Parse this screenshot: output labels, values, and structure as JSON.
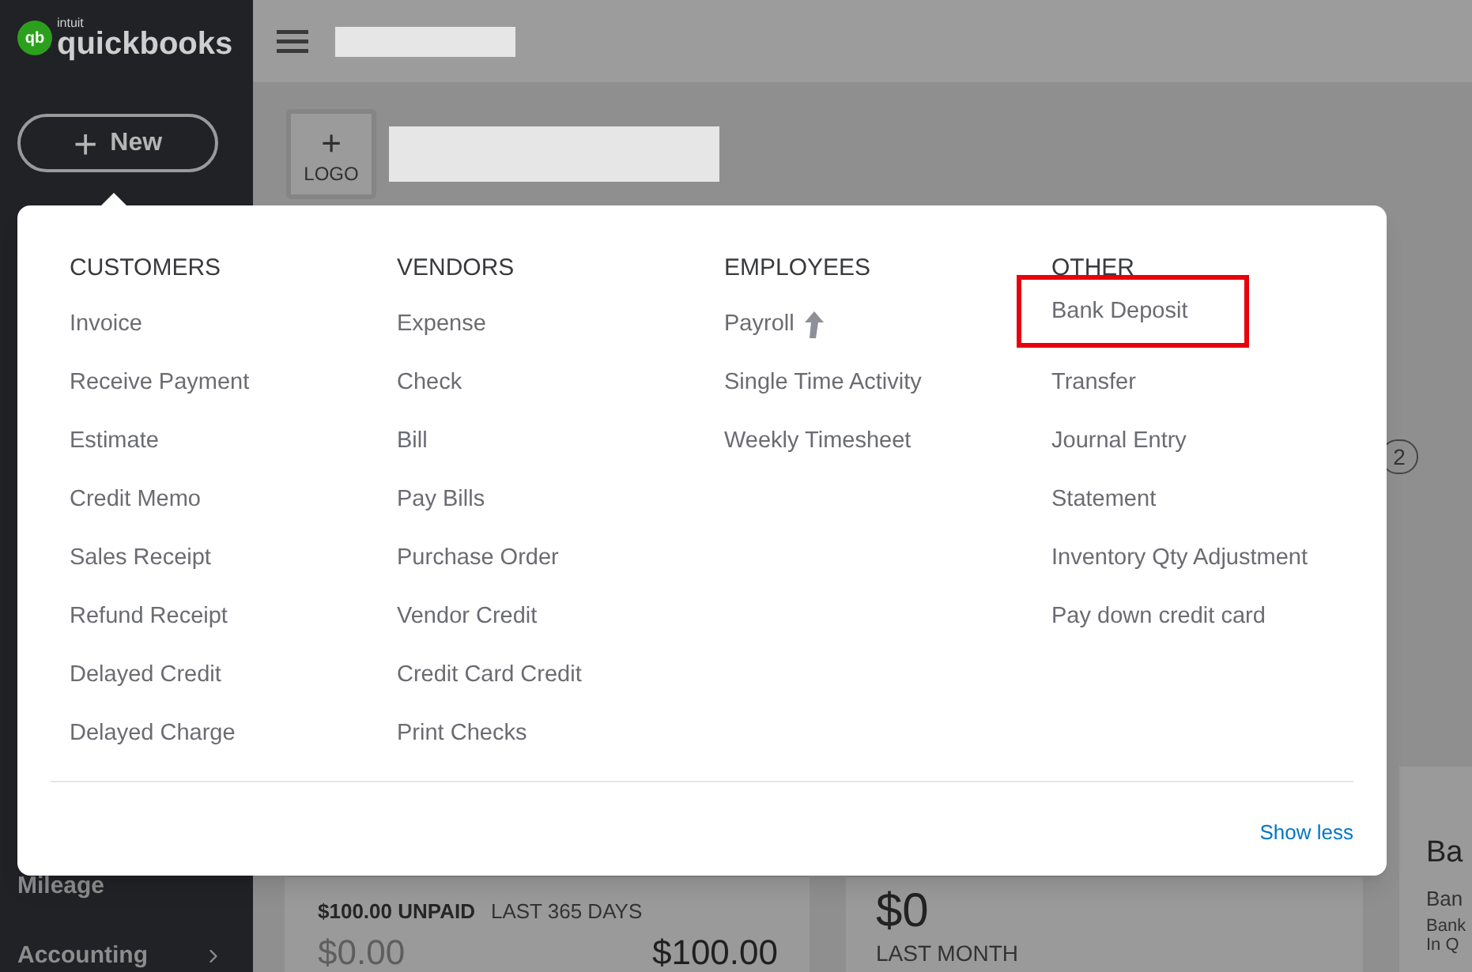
{
  "sidebar": {
    "logo": {
      "brand_small": "intuit",
      "brand": "quickbooks",
      "badge": "qb"
    },
    "new_button": {
      "label": "New",
      "icon": "+"
    },
    "items": [
      {
        "label": "Mileage",
        "has_submenu": false
      },
      {
        "label": "Accounting",
        "has_submenu": true
      }
    ]
  },
  "header": {
    "logo_button": {
      "icon": "+",
      "label": "LOGO"
    }
  },
  "new_menu": {
    "columns": [
      {
        "heading": "CUSTOMERS",
        "items": [
          {
            "label": "Invoice",
            "highlighted": false,
            "upgrade": false
          },
          {
            "label": "Receive Payment",
            "highlighted": false,
            "upgrade": false
          },
          {
            "label": "Estimate",
            "highlighted": false,
            "upgrade": false
          },
          {
            "label": "Credit Memo",
            "highlighted": false,
            "upgrade": false
          },
          {
            "label": "Sales Receipt",
            "highlighted": false,
            "upgrade": false
          },
          {
            "label": "Refund Receipt",
            "highlighted": false,
            "upgrade": false
          },
          {
            "label": "Delayed Credit",
            "highlighted": false,
            "upgrade": false
          },
          {
            "label": "Delayed Charge",
            "highlighted": false,
            "upgrade": false
          }
        ]
      },
      {
        "heading": "VENDORS",
        "items": [
          {
            "label": "Expense",
            "highlighted": false,
            "upgrade": false
          },
          {
            "label": "Check",
            "highlighted": false,
            "upgrade": false
          },
          {
            "label": "Bill",
            "highlighted": false,
            "upgrade": false
          },
          {
            "label": "Pay Bills",
            "highlighted": false,
            "upgrade": false
          },
          {
            "label": "Purchase Order",
            "highlighted": false,
            "upgrade": false
          },
          {
            "label": "Vendor Credit",
            "highlighted": false,
            "upgrade": false
          },
          {
            "label": "Credit Card Credit",
            "highlighted": false,
            "upgrade": false
          },
          {
            "label": "Print Checks",
            "highlighted": false,
            "upgrade": false
          }
        ]
      },
      {
        "heading": "EMPLOYEES",
        "items": [
          {
            "label": "Payroll",
            "highlighted": false,
            "upgrade": true
          },
          {
            "label": "Single Time Activity",
            "highlighted": false,
            "upgrade": false
          },
          {
            "label": "Weekly Timesheet",
            "highlighted": false,
            "upgrade": false
          }
        ]
      },
      {
        "heading": "OTHER",
        "items": [
          {
            "label": "Bank Deposit",
            "highlighted": true,
            "upgrade": false
          },
          {
            "label": "Transfer",
            "highlighted": false,
            "upgrade": false
          },
          {
            "label": "Journal Entry",
            "highlighted": false,
            "upgrade": false
          },
          {
            "label": "Statement",
            "highlighted": false,
            "upgrade": false
          },
          {
            "label": "Inventory Qty Adjustment",
            "highlighted": false,
            "upgrade": false
          },
          {
            "label": "Pay down credit card",
            "highlighted": false,
            "upgrade": false
          }
        ]
      }
    ],
    "show_less": "Show less"
  },
  "background": {
    "step_number": "2",
    "cards": [
      {
        "kind": "invoices",
        "summary": "$100.00 UNPAID",
        "period": "LAST 365 DAYS",
        "value_left": "$0.00",
        "value_right": "$100.00"
      },
      {
        "kind": "amount",
        "amount": "$0",
        "period": "LAST MONTH"
      },
      {
        "kind": "bank",
        "title": "Ba",
        "line_1": "Ban",
        "line_2": "Bank",
        "line_3": "In Q"
      }
    ]
  }
}
